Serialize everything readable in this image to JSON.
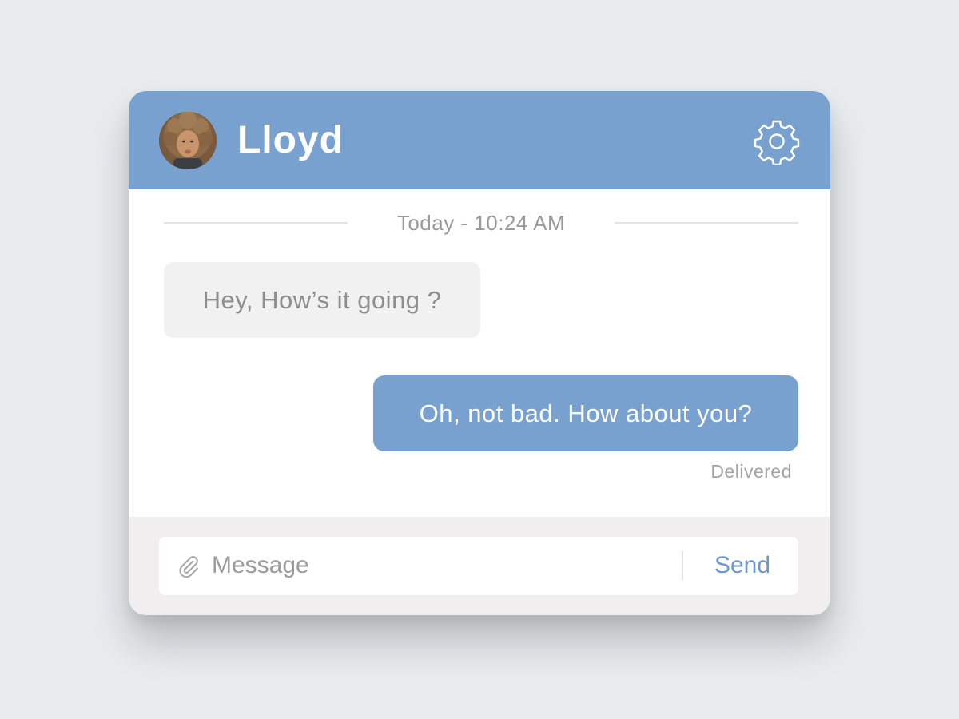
{
  "header": {
    "contact_name": "Lloyd",
    "avatar_icon": "person-avatar",
    "settings_icon": "gear-icon"
  },
  "conversation": {
    "timestamp": "Today - 10:24 AM",
    "messages": [
      {
        "direction": "incoming",
        "text": "Hey, How’s it going ?"
      },
      {
        "direction": "outgoing",
        "text": "Oh, not bad. How about you?"
      }
    ],
    "status": "Delivered"
  },
  "composer": {
    "attach_icon": "paperclip-icon",
    "placeholder": "Message",
    "value": "",
    "send_label": "Send"
  },
  "colors": {
    "accent": "#78a1cf",
    "background": "#e8ecef",
    "incoming_bubble": "#f1f1f2",
    "composer_bg": "#f0eeee",
    "send_text": "#6c98cb"
  }
}
